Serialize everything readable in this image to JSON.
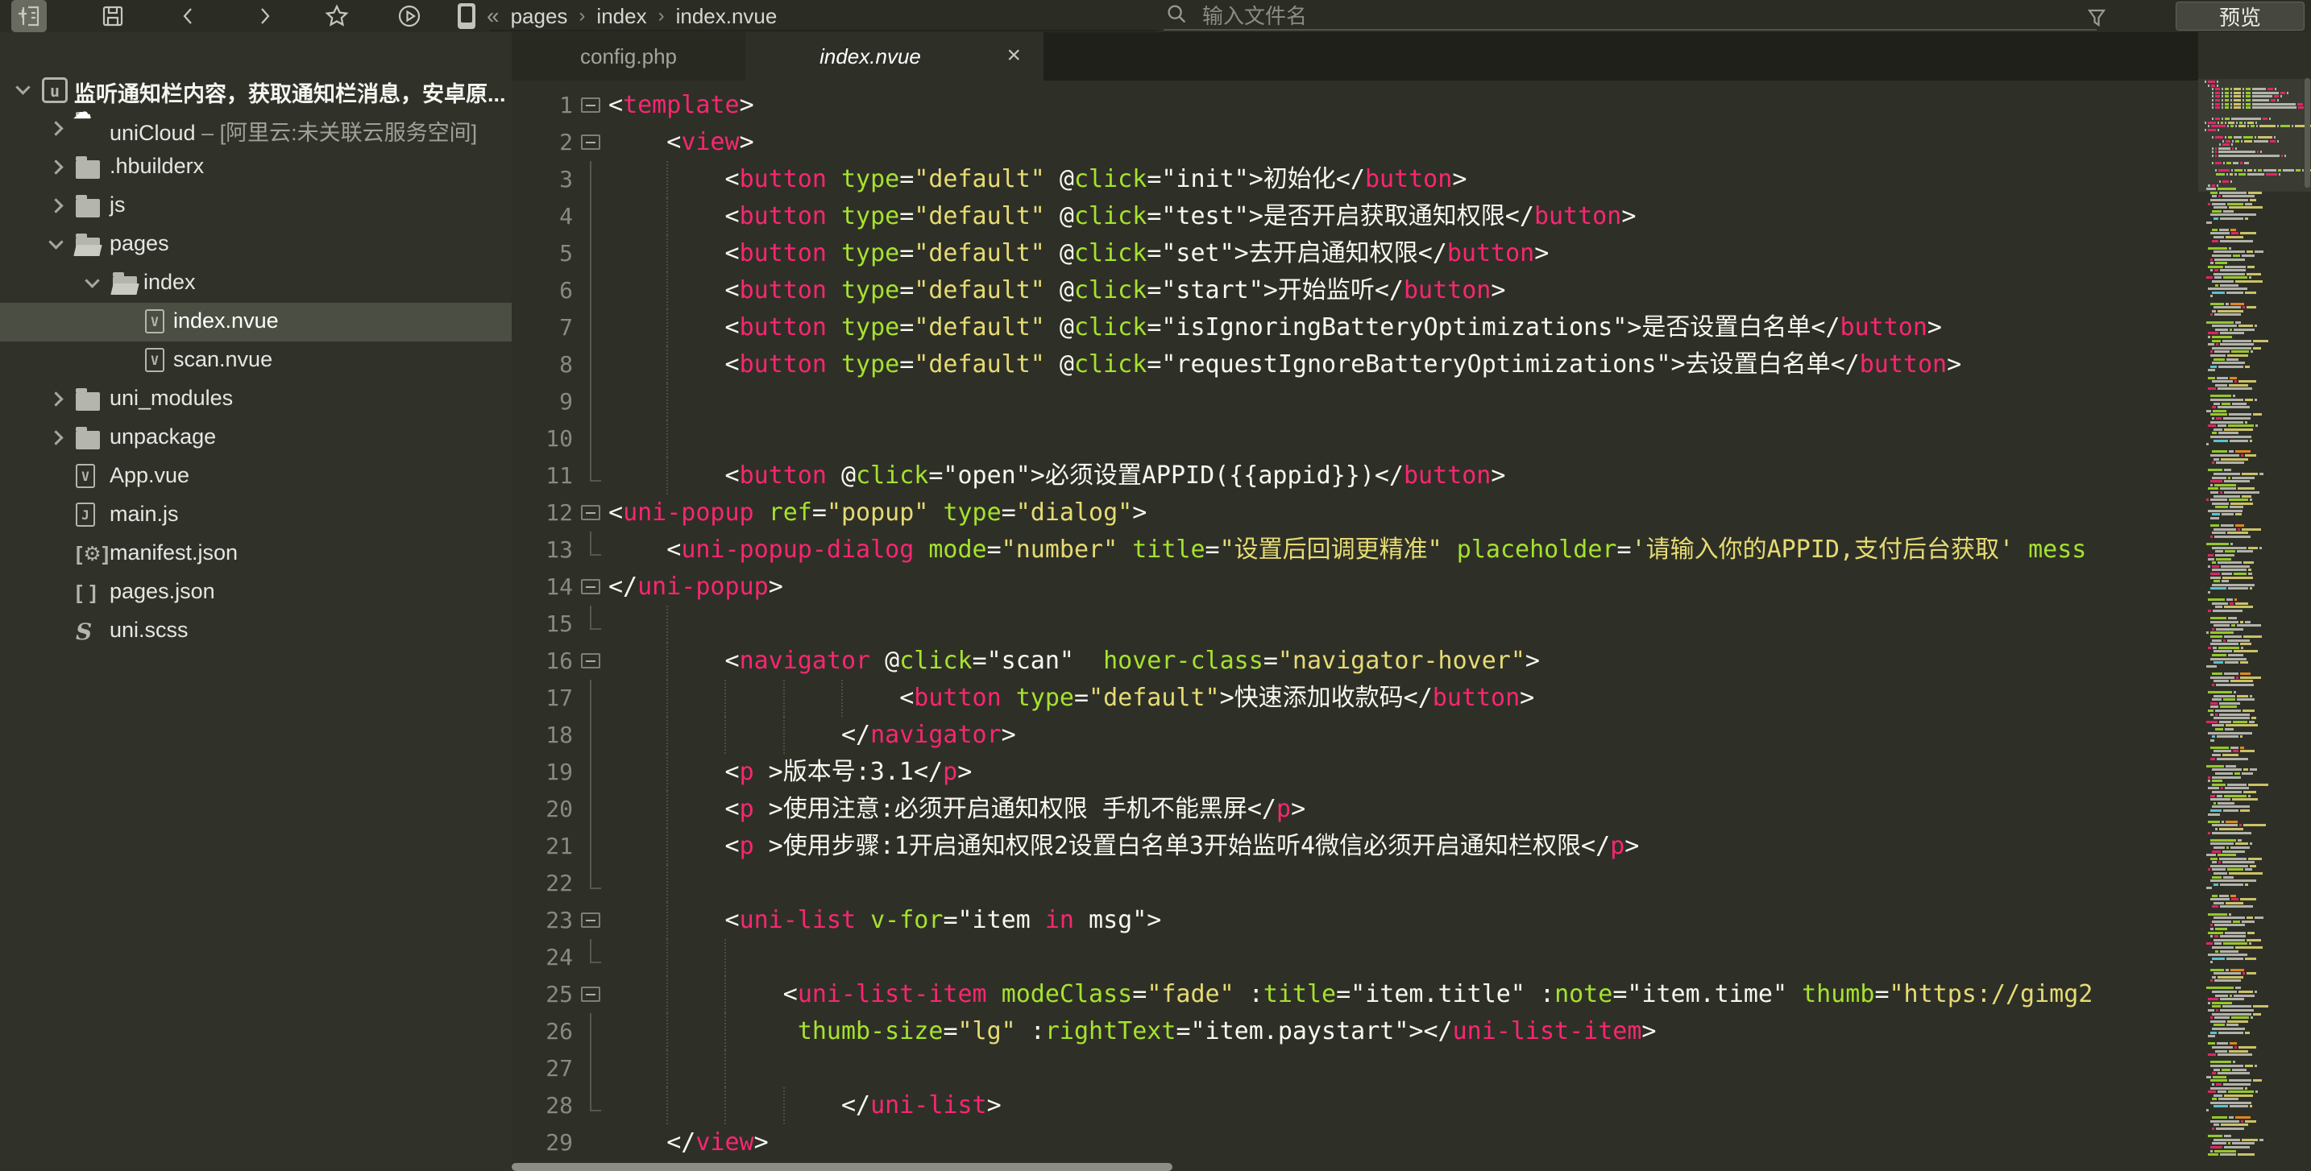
{
  "colors": {
    "editor_bg": "#2e3027",
    "sidebar_bg": "#30322a",
    "toolbar_bg": "#2b2d25",
    "tabstrip_bg": "#1e2019",
    "inactive_tab_bg": "#282a22",
    "selected_row_bg": "#4b4e42",
    "tag_pink": "#f92672",
    "attr_green": "#a6e22e",
    "string_khaki": "#e6db74",
    "plain_white": "#f8f8f2",
    "line_number_gray": "#878a7e"
  },
  "toolbar": {
    "icons": [
      "new",
      "save",
      "back",
      "forward",
      "star",
      "run"
    ],
    "collapse_glyph": "«",
    "breadcrumb": [
      "pages",
      "index",
      "index.nvue"
    ],
    "crumb_separator": "›",
    "search": {
      "placeholder": "输入文件名"
    },
    "preview_label": "预览"
  },
  "tabs": [
    {
      "label": "config.php",
      "active": false
    },
    {
      "label": "index.nvue",
      "active": true,
      "close": "×"
    }
  ],
  "sidebar": {
    "items": [
      {
        "label": "监听通知栏内容，获取通知栏消息，安卓原...",
        "icon": "project",
        "level": 0,
        "chevron": "down",
        "kind": "project"
      },
      {
        "label": "uniCloud",
        "suffix": " – [阿里云:未关联云服务空间]",
        "icon": "cloud-folder",
        "level": 1,
        "chevron": "right"
      },
      {
        "label": ".hbuilderx",
        "icon": "folder",
        "level": 1,
        "chevron": "right"
      },
      {
        "label": "js",
        "icon": "folder",
        "level": 1,
        "chevron": "right"
      },
      {
        "label": "pages",
        "icon": "folder-open",
        "level": 1,
        "chevron": "down"
      },
      {
        "label": "index",
        "icon": "folder-open",
        "level": 2,
        "chevron": "down"
      },
      {
        "label": "index.nvue",
        "icon": "vue-file",
        "level": 3,
        "chevron": "none",
        "selected": true
      },
      {
        "label": "scan.nvue",
        "icon": "vue-file",
        "level": 3,
        "chevron": "none"
      },
      {
        "label": "uni_modules",
        "icon": "folder",
        "level": 1,
        "chevron": "right"
      },
      {
        "label": "unpackage",
        "icon": "folder",
        "level": 1,
        "chevron": "right"
      },
      {
        "label": "App.vue",
        "icon": "vue-file",
        "level": 1,
        "chevron": "none"
      },
      {
        "label": "main.js",
        "icon": "js-file",
        "level": 1,
        "chevron": "none"
      },
      {
        "label": "manifest.json",
        "icon": "manifest-json",
        "level": 1,
        "chevron": "none"
      },
      {
        "label": "pages.json",
        "icon": "brackets-json",
        "level": 1,
        "chevron": "none"
      },
      {
        "label": "uni.scss",
        "icon": "scss-file",
        "level": 1,
        "chevron": "none"
      }
    ]
  },
  "editor": {
    "lines": [
      {
        "n": 1,
        "ind": 0,
        "f": 1,
        "g": [],
        "s": [
          [
            "p",
            "<"
          ],
          [
            "t",
            "template"
          ],
          [
            "p",
            ">"
          ]
        ]
      },
      {
        "n": 2,
        "ind": 4,
        "f": 1,
        "g": [],
        "s": [
          [
            "p",
            "<"
          ],
          [
            "t",
            "view"
          ],
          [
            "p",
            ">"
          ]
        ]
      },
      {
        "n": 3,
        "ind": 8,
        "f": 0,
        "g": [
          4
        ],
        "s": [
          [
            "p",
            "<"
          ],
          [
            "t",
            "button"
          ],
          [
            "p",
            " "
          ],
          [
            "a",
            "type"
          ],
          [
            "p",
            "="
          ],
          [
            "s",
            "\"default\""
          ],
          [
            "p",
            " @"
          ],
          [
            "a",
            "click"
          ],
          [
            "p",
            "=\"init\">初始化</"
          ],
          [
            "t",
            "button"
          ],
          [
            "p",
            ">"
          ]
        ]
      },
      {
        "n": 4,
        "ind": 8,
        "f": 0,
        "g": [
          4
        ],
        "s": [
          [
            "p",
            "<"
          ],
          [
            "t",
            "button"
          ],
          [
            "p",
            " "
          ],
          [
            "a",
            "type"
          ],
          [
            "p",
            "="
          ],
          [
            "s",
            "\"default\""
          ],
          [
            "p",
            " @"
          ],
          [
            "a",
            "click"
          ],
          [
            "p",
            "=\"test\">是否开启获取通知权限</"
          ],
          [
            "t",
            "button"
          ],
          [
            "p",
            ">"
          ]
        ]
      },
      {
        "n": 5,
        "ind": 8,
        "f": 0,
        "g": [
          4
        ],
        "s": [
          [
            "p",
            "<"
          ],
          [
            "t",
            "button"
          ],
          [
            "p",
            " "
          ],
          [
            "a",
            "type"
          ],
          [
            "p",
            "="
          ],
          [
            "s",
            "\"default\""
          ],
          [
            "p",
            " @"
          ],
          [
            "a",
            "click"
          ],
          [
            "p",
            "=\"set\">去开启通知权限</"
          ],
          [
            "t",
            "button"
          ],
          [
            "p",
            ">"
          ]
        ]
      },
      {
        "n": 6,
        "ind": 8,
        "f": 0,
        "g": [
          4
        ],
        "s": [
          [
            "p",
            "<"
          ],
          [
            "t",
            "button"
          ],
          [
            "p",
            " "
          ],
          [
            "a",
            "type"
          ],
          [
            "p",
            "="
          ],
          [
            "s",
            "\"default\""
          ],
          [
            "p",
            " @"
          ],
          [
            "a",
            "click"
          ],
          [
            "p",
            "=\"start\">开始监听</"
          ],
          [
            "t",
            "button"
          ],
          [
            "p",
            ">"
          ]
        ]
      },
      {
        "n": 7,
        "ind": 8,
        "f": 0,
        "g": [
          4
        ],
        "s": [
          [
            "p",
            "<"
          ],
          [
            "t",
            "button"
          ],
          [
            "p",
            " "
          ],
          [
            "a",
            "type"
          ],
          [
            "p",
            "="
          ],
          [
            "s",
            "\"default\""
          ],
          [
            "p",
            " @"
          ],
          [
            "a",
            "click"
          ],
          [
            "p",
            "=\"isIgnoringBatteryOptimizations\">是否设置白名单</"
          ],
          [
            "t",
            "button"
          ],
          [
            "p",
            ">"
          ]
        ]
      },
      {
        "n": 8,
        "ind": 8,
        "f": 0,
        "g": [
          4
        ],
        "s": [
          [
            "p",
            "<"
          ],
          [
            "t",
            "button"
          ],
          [
            "p",
            " "
          ],
          [
            "a",
            "type"
          ],
          [
            "p",
            "="
          ],
          [
            "s",
            "\"default\""
          ],
          [
            "p",
            " @"
          ],
          [
            "a",
            "click"
          ],
          [
            "p",
            "=\"requestIgnoreBatteryOptimizations\">去设置白名单</"
          ],
          [
            "t",
            "button"
          ],
          [
            "p",
            ">"
          ]
        ]
      },
      {
        "n": 9,
        "ind": 0,
        "f": 0,
        "g": [
          4
        ],
        "s": []
      },
      {
        "n": 10,
        "ind": 0,
        "f": 0,
        "g": [
          4
        ],
        "s": []
      },
      {
        "n": 11,
        "ind": 8,
        "f": 0,
        "g": [
          4
        ],
        "s": [
          [
            "p",
            "<"
          ],
          [
            "t",
            "button"
          ],
          [
            "p",
            " @"
          ],
          [
            "a",
            "click"
          ],
          [
            "p",
            "=\"open\">必须设置APPID({{appid}})</"
          ],
          [
            "t",
            "button"
          ],
          [
            "p",
            ">"
          ]
        ]
      },
      {
        "n": 12,
        "ind": 0,
        "f": 1,
        "g": [],
        "s": [
          [
            "p",
            "<"
          ],
          [
            "t",
            "uni-popup"
          ],
          [
            "p",
            " "
          ],
          [
            "a",
            "ref"
          ],
          [
            "p",
            "="
          ],
          [
            "s",
            "\"popup\""
          ],
          [
            "p",
            " "
          ],
          [
            "a",
            "type"
          ],
          [
            "p",
            "="
          ],
          [
            "s",
            "\"dialog\""
          ],
          [
            "p",
            ">"
          ]
        ]
      },
      {
        "n": 13,
        "ind": 4,
        "f": 0,
        "g": [],
        "s": [
          [
            "p",
            "<"
          ],
          [
            "t",
            "uni-popup-dialog"
          ],
          [
            "p",
            " "
          ],
          [
            "a",
            "mode"
          ],
          [
            "p",
            "="
          ],
          [
            "s",
            "\"number\""
          ],
          [
            "p",
            " "
          ],
          [
            "a",
            "title"
          ],
          [
            "p",
            "="
          ],
          [
            "s",
            "\"设置后回调更精准\""
          ],
          [
            "p",
            " "
          ],
          [
            "a",
            "placeholder"
          ],
          [
            "p",
            "="
          ],
          [
            "s",
            "'请输入你的APPID,支付后台获取'"
          ],
          [
            "p",
            " "
          ],
          [
            "a",
            "mess"
          ]
        ]
      },
      {
        "n": 14,
        "ind": 0,
        "f": 1,
        "g": [],
        "s": [
          [
            "p",
            "</"
          ],
          [
            "t",
            "uni-popup"
          ],
          [
            "p",
            ">"
          ]
        ]
      },
      {
        "n": 15,
        "ind": 0,
        "f": 0,
        "g": [
          4
        ],
        "s": []
      },
      {
        "n": 16,
        "ind": 8,
        "f": 1,
        "g": [
          4
        ],
        "s": [
          [
            "p",
            "<"
          ],
          [
            "t",
            "navigator"
          ],
          [
            "p",
            " @"
          ],
          [
            "a",
            "click"
          ],
          [
            "p",
            "=\"scan\"  "
          ],
          [
            "a",
            "hover-class"
          ],
          [
            "p",
            "="
          ],
          [
            "s",
            "\"navigator-hover\""
          ],
          [
            "p",
            ">"
          ]
        ]
      },
      {
        "n": 17,
        "ind": 20,
        "f": 0,
        "g": [
          4,
          8,
          12,
          16
        ],
        "s": [
          [
            "p",
            "<"
          ],
          [
            "t",
            "button"
          ],
          [
            "p",
            " "
          ],
          [
            "a",
            "type"
          ],
          [
            "p",
            "="
          ],
          [
            "s",
            "\"default\""
          ],
          [
            "p",
            ">快速添加收款码</"
          ],
          [
            "t",
            "button"
          ],
          [
            "p",
            ">"
          ]
        ]
      },
      {
        "n": 18,
        "ind": 16,
        "f": 0,
        "g": [
          4,
          8,
          12
        ],
        "s": [
          [
            "p",
            "</"
          ],
          [
            "t",
            "navigator"
          ],
          [
            "p",
            ">"
          ]
        ]
      },
      {
        "n": 19,
        "ind": 8,
        "f": 0,
        "g": [
          4
        ],
        "s": [
          [
            "p",
            "<"
          ],
          [
            "t",
            "p"
          ],
          [
            "p",
            " >版本号:3.1</"
          ],
          [
            "t",
            "p"
          ],
          [
            "p",
            ">"
          ]
        ]
      },
      {
        "n": 20,
        "ind": 8,
        "f": 0,
        "g": [
          4
        ],
        "s": [
          [
            "p",
            "<"
          ],
          [
            "t",
            "p"
          ],
          [
            "p",
            " >使用注意:必须开启通知权限 手机不能黑屏</"
          ],
          [
            "t",
            "p"
          ],
          [
            "p",
            ">"
          ]
        ]
      },
      {
        "n": 21,
        "ind": 8,
        "f": 0,
        "g": [
          4
        ],
        "s": [
          [
            "p",
            "<"
          ],
          [
            "t",
            "p"
          ],
          [
            "p",
            " >使用步骤:1开启通知权限2设置白名单3开始监听4微信必须开启通知栏权限</"
          ],
          [
            "t",
            "p"
          ],
          [
            "p",
            ">"
          ]
        ]
      },
      {
        "n": 22,
        "ind": 0,
        "f": 0,
        "g": [
          4
        ],
        "s": []
      },
      {
        "n": 23,
        "ind": 8,
        "f": 1,
        "g": [
          4
        ],
        "s": [
          [
            "p",
            "<"
          ],
          [
            "t",
            "uni-list"
          ],
          [
            "p",
            " "
          ],
          [
            "a",
            "v-for"
          ],
          [
            "p",
            "=\"item "
          ],
          [
            "k",
            "in"
          ],
          [
            "p",
            " msg\">"
          ]
        ]
      },
      {
        "n": 24,
        "ind": 0,
        "f": 0,
        "g": [
          4,
          8
        ],
        "s": []
      },
      {
        "n": 25,
        "ind": 12,
        "f": 1,
        "g": [
          4,
          8
        ],
        "s": [
          [
            "p",
            "<"
          ],
          [
            "t",
            "uni-list-item"
          ],
          [
            "p",
            " "
          ],
          [
            "a",
            "modeClass"
          ],
          [
            "p",
            "="
          ],
          [
            "s",
            "\"fade\""
          ],
          [
            "p",
            " :"
          ],
          [
            "a",
            "title"
          ],
          [
            "p",
            "=\"item.title\" :"
          ],
          [
            "a",
            "note"
          ],
          [
            "p",
            "=\"item.time\" "
          ],
          [
            "a",
            "thumb"
          ],
          [
            "p",
            "="
          ],
          [
            "s",
            "\"https://gimg2"
          ]
        ]
      },
      {
        "n": 26,
        "ind": 13,
        "f": 0,
        "g": [
          4,
          8
        ],
        "s": [
          [
            "a",
            "thumb-size"
          ],
          [
            "p",
            "="
          ],
          [
            "s",
            "\"lg\""
          ],
          [
            "p",
            " :"
          ],
          [
            "a",
            "rightText"
          ],
          [
            "p",
            "=\"item.paystart\"></"
          ],
          [
            "t",
            "uni-list-item"
          ],
          [
            "p",
            ">"
          ]
        ]
      },
      {
        "n": 27,
        "ind": 0,
        "f": 0,
        "g": [
          4,
          8
        ],
        "s": []
      },
      {
        "n": 28,
        "ind": 16,
        "f": 0,
        "g": [
          4,
          8,
          12
        ],
        "s": [
          [
            "p",
            "</"
          ],
          [
            "t",
            "uni-list"
          ],
          [
            "p",
            ">"
          ]
        ]
      },
      {
        "n": 29,
        "ind": 4,
        "f": 0,
        "g": [],
        "s": [
          [
            "p",
            "</"
          ],
          [
            "t",
            "view"
          ],
          [
            "p",
            ">"
          ]
        ]
      }
    ]
  }
}
